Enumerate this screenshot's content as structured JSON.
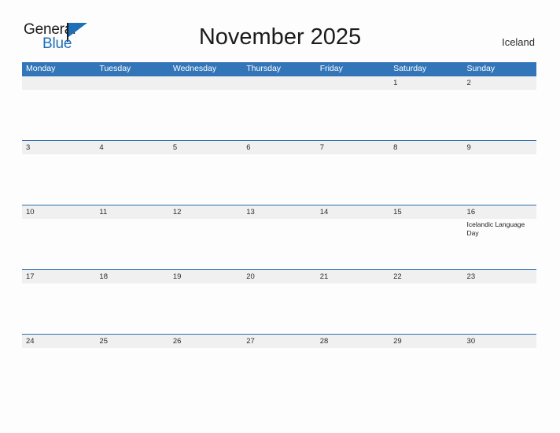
{
  "brand": {
    "name_part1": "General",
    "name_part2": "Blue",
    "flag_icon": "blue-flag-triangle"
  },
  "header": {
    "title": "November 2025",
    "region": "Iceland"
  },
  "calendar": {
    "weekday_headers": [
      "Monday",
      "Tuesday",
      "Wednesday",
      "Thursday",
      "Friday",
      "Saturday",
      "Sunday"
    ],
    "weeks": [
      {
        "days": [
          {
            "date": "",
            "event": ""
          },
          {
            "date": "",
            "event": ""
          },
          {
            "date": "",
            "event": ""
          },
          {
            "date": "",
            "event": ""
          },
          {
            "date": "",
            "event": ""
          },
          {
            "date": "1",
            "event": ""
          },
          {
            "date": "2",
            "event": ""
          }
        ]
      },
      {
        "days": [
          {
            "date": "3",
            "event": ""
          },
          {
            "date": "4",
            "event": ""
          },
          {
            "date": "5",
            "event": ""
          },
          {
            "date": "6",
            "event": ""
          },
          {
            "date": "7",
            "event": ""
          },
          {
            "date": "8",
            "event": ""
          },
          {
            "date": "9",
            "event": ""
          }
        ]
      },
      {
        "days": [
          {
            "date": "10",
            "event": ""
          },
          {
            "date": "11",
            "event": ""
          },
          {
            "date": "12",
            "event": ""
          },
          {
            "date": "13",
            "event": ""
          },
          {
            "date": "14",
            "event": ""
          },
          {
            "date": "15",
            "event": ""
          },
          {
            "date": "16",
            "event": "Icelandic Language Day"
          }
        ]
      },
      {
        "days": [
          {
            "date": "17",
            "event": ""
          },
          {
            "date": "18",
            "event": ""
          },
          {
            "date": "19",
            "event": ""
          },
          {
            "date": "20",
            "event": ""
          },
          {
            "date": "21",
            "event": ""
          },
          {
            "date": "22",
            "event": ""
          },
          {
            "date": "23",
            "event": ""
          }
        ]
      },
      {
        "days": [
          {
            "date": "24",
            "event": ""
          },
          {
            "date": "25",
            "event": ""
          },
          {
            "date": "26",
            "event": ""
          },
          {
            "date": "27",
            "event": ""
          },
          {
            "date": "28",
            "event": ""
          },
          {
            "date": "29",
            "event": ""
          },
          {
            "date": "30",
            "event": ""
          }
        ]
      }
    ]
  },
  "colors": {
    "header_blue": "#3275b8",
    "divider_blue": "#2f6fae",
    "brand_blue": "#1d6fb8",
    "day_band_gray": "#f0f0f0",
    "text_dark": "#1b1b1b"
  }
}
